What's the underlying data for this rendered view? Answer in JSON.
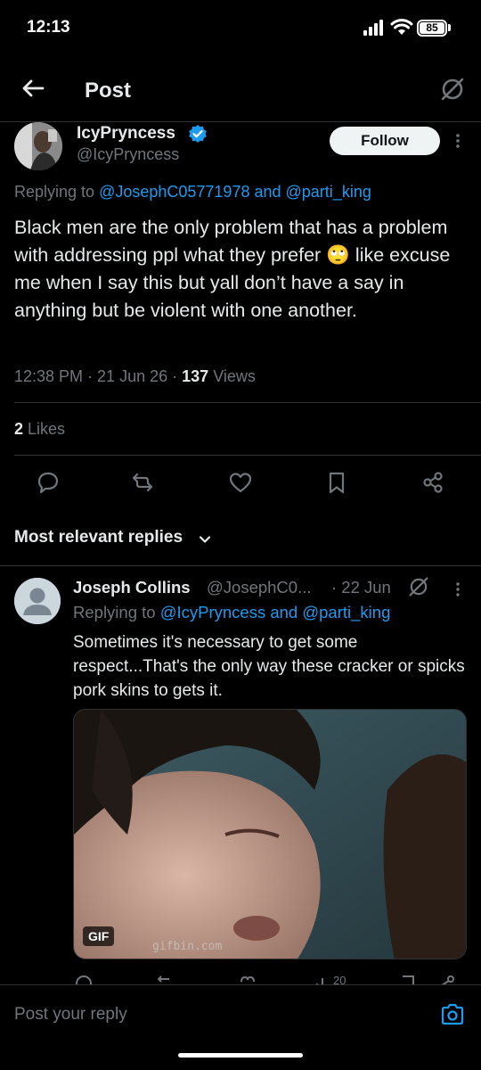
{
  "status_bar": {
    "time": "12:13",
    "battery": "85"
  },
  "header": {
    "title": "Post"
  },
  "post": {
    "name": "IcyPryncess",
    "handle": "@IcyPryncess",
    "follow_label": "Follow",
    "replying_prefix": "Replying to ",
    "replying_user1": "@JosephC05771978",
    "replying_and": " and ",
    "replying_user2": "@parti_king",
    "text_part1": "Black men are the only problem that has a problem with addressing ppl what they prefer ",
    "emoji": "🙄",
    "text_part2": " like excuse me when I say this but yall don’t have a say in anything but be violent with one another.",
    "time": "12:38 PM",
    "date": "21 Jun 26",
    "views_count": "137",
    "views_label": "Views",
    "likes_count": "2",
    "likes_label": "Likes"
  },
  "replies_header": {
    "label": "Most relevant replies"
  },
  "reply": {
    "name": "Joseph Collins",
    "handle": "@JosephC0...",
    "date": "· 22 Jun",
    "replying_prefix": "Replying to ",
    "replying_user1": "@IcyPryncess",
    "replying_and": " and ",
    "replying_user2": "@parti_king",
    "text": "Sometimes it's necessary to get some respect...That's the only way these cracker or spicks pork skins to gets it.",
    "gif_badge": "GIF",
    "watermark": "gifbin.com",
    "views_count": "20"
  },
  "compose": {
    "placeholder": "Post your reply"
  },
  "colors": {
    "accent": "#1d9bf0",
    "muted": "#71767b",
    "text": "#e7e9ea",
    "divider": "#2f3336"
  }
}
